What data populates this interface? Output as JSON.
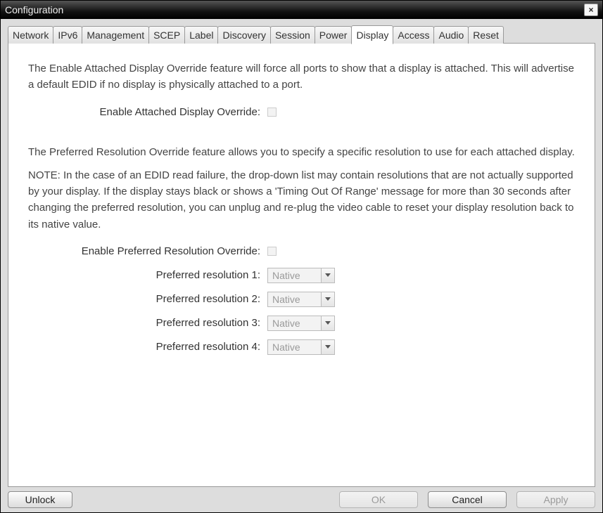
{
  "window": {
    "title": "Configuration"
  },
  "tabs": [
    {
      "label": "Network",
      "active": false
    },
    {
      "label": "IPv6",
      "active": false
    },
    {
      "label": "Management",
      "active": false
    },
    {
      "label": "SCEP",
      "active": false
    },
    {
      "label": "Label",
      "active": false
    },
    {
      "label": "Discovery",
      "active": false
    },
    {
      "label": "Session",
      "active": false
    },
    {
      "label": "Power",
      "active": false
    },
    {
      "label": "Display",
      "active": true
    },
    {
      "label": "Access",
      "active": false
    },
    {
      "label": "Audio",
      "active": false
    },
    {
      "label": "Reset",
      "active": false
    }
  ],
  "display_tab": {
    "desc_attached": "The Enable Attached Display Override feature will force all ports to show that a display is attached. This will advertise a default EDID if no display is physically attached to a port.",
    "label_attached": "Enable Attached Display Override:",
    "attached_checked": false,
    "desc_preferred": "The Preferred Resolution Override feature allows you to specify a specific resolution to use for each attached display.",
    "note_preferred": "NOTE: In the case of an EDID read failure, the drop-down list may contain resolutions that are not actually supported by your display. If the display stays black or shows a 'Timing Out Of Range' message for more than 30 seconds after changing the preferred resolution, you can unplug and re-plug the video cable to reset your display resolution back to its native value.",
    "label_pref_enable": "Enable Preferred Resolution Override:",
    "pref_checked": false,
    "res_rows": [
      {
        "label": "Preferred resolution 1:",
        "value": "Native"
      },
      {
        "label": "Preferred resolution 2:",
        "value": "Native"
      },
      {
        "label": "Preferred resolution 3:",
        "value": "Native"
      },
      {
        "label": "Preferred resolution 4:",
        "value": "Native"
      }
    ]
  },
  "buttons": {
    "unlock": "Unlock",
    "ok": "OK",
    "cancel": "Cancel",
    "apply": "Apply"
  }
}
